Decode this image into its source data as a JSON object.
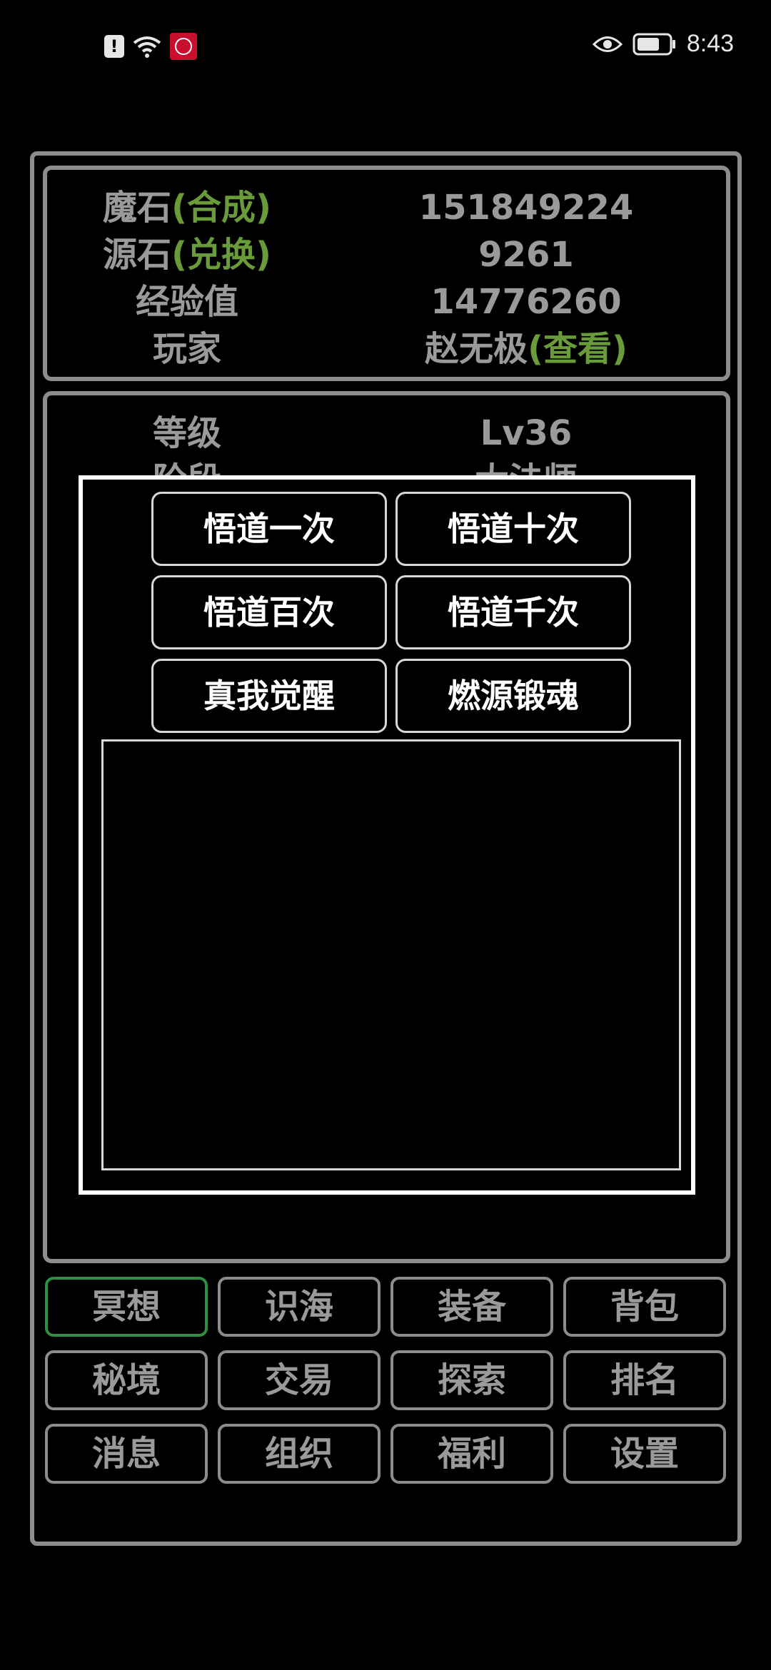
{
  "status_bar": {
    "time": "8:43",
    "icons": [
      "alert-icon",
      "wifi-icon",
      "app-icon",
      "eye-icon",
      "battery-icon"
    ]
  },
  "info": {
    "rows": [
      {
        "label": "魔石",
        "action": "(合成)",
        "value": "151849224"
      },
      {
        "label": "源石",
        "action": "(兑换)",
        "value": "9261"
      },
      {
        "label": "经验值",
        "value": "14776260"
      },
      {
        "label": "玩家",
        "value": "赵无极",
        "action": "(查看)"
      }
    ]
  },
  "stats": {
    "level_label": "等级",
    "level_value": "Lv36",
    "stage_label": "阶段",
    "stage_value": "大法师"
  },
  "dialog": {
    "buttons": [
      "悟道一次",
      "悟道十次",
      "悟道百次",
      "悟道千次",
      "真我觉醒",
      "燃源锻魂"
    ]
  },
  "nav": {
    "active_index": 0,
    "items": [
      "冥想",
      "识海",
      "装备",
      "背包",
      "秘境",
      "交易",
      "探索",
      "排名",
      "消息",
      "组织",
      "福利",
      "设置"
    ]
  },
  "colors": {
    "accent_green": "#6a9b3a",
    "active_border": "#2f8f3f",
    "text_gray": "#9a9a9a",
    "border_gray": "#8c8c8c"
  }
}
